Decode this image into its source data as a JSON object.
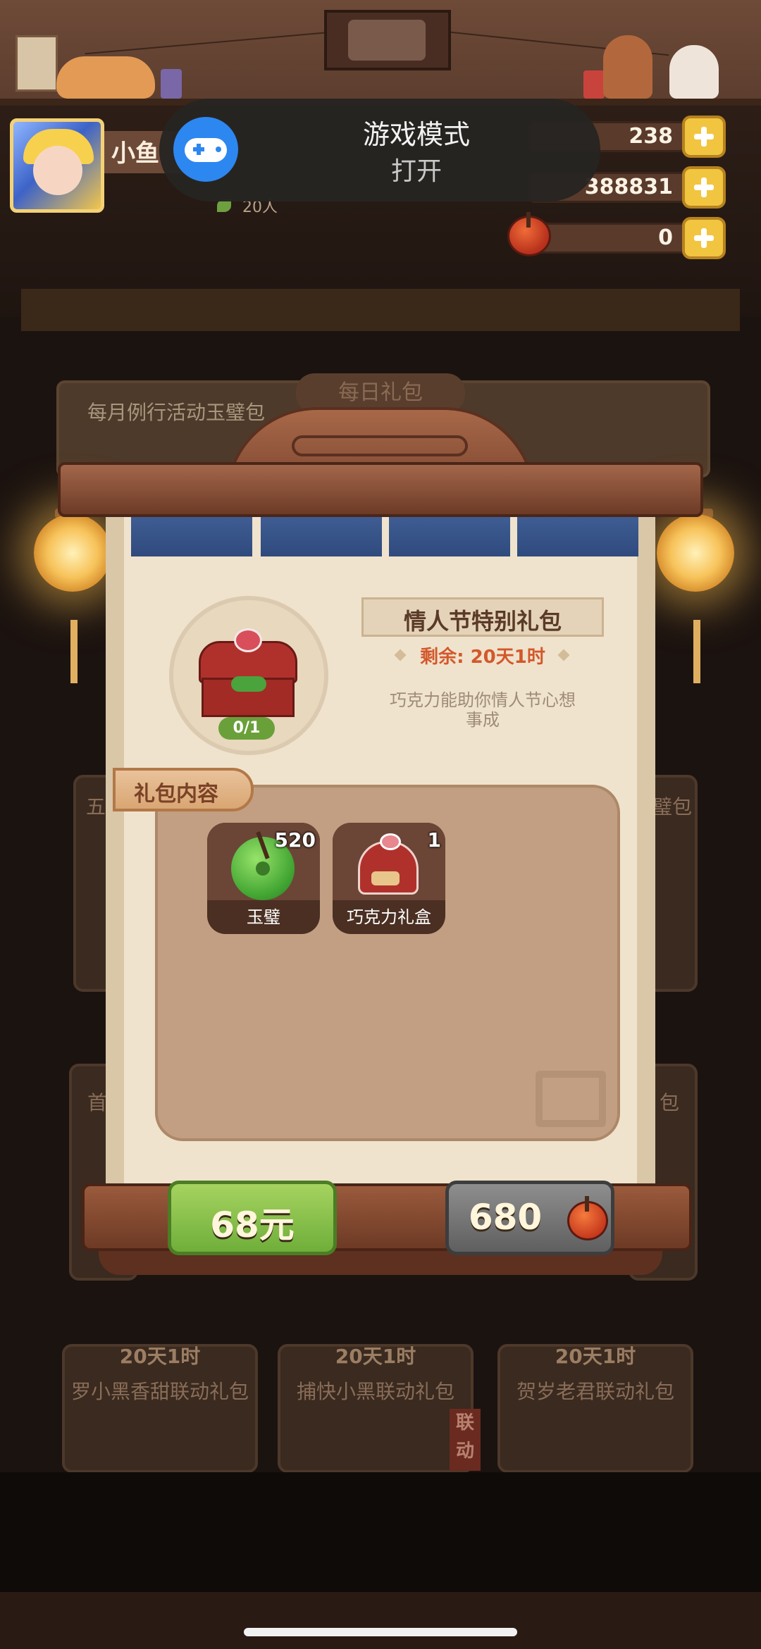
{
  "hud": {
    "player_name": "小鱼",
    "sub_count": "20人",
    "resources": [
      {
        "name": "gems",
        "value": "238"
      },
      {
        "name": "coins",
        "value": "388831"
      },
      {
        "name": "red-jade",
        "value": "0"
      }
    ]
  },
  "game_mode": {
    "title": "游戏模式",
    "state": "打开",
    "accent": "#2d87f0"
  },
  "background": {
    "tab_label": "每日礼包",
    "header_text": "每月例行活动玉璧包",
    "side_left": "五",
    "side_right": "璧包",
    "side_left2": "首",
    "side_right2": "包",
    "bottom_cards": [
      {
        "timer": "20天1时",
        "name": "罗小黑香甜联动礼包"
      },
      {
        "timer": "20天1时",
        "name": "捕快小黑联动礼包"
      },
      {
        "timer": "20天1时",
        "name": "贺岁老君联动礼包"
      }
    ],
    "ribbon_tag": "联动"
  },
  "modal": {
    "title": "情人节特别礼包",
    "remaining": "剩余: 20天1时",
    "description": "巧克力能助你情人节心想事成",
    "progress": "0/1",
    "content_label": "礼包内容",
    "items": [
      {
        "name": "玉璧",
        "count": "520",
        "icon": "jade-disc-icon"
      },
      {
        "name": "巧克力礼盒",
        "count": "1",
        "icon": "chocolate-gift-box-icon"
      }
    ],
    "buy_cash_label": "68元",
    "buy_jade_label": "680"
  },
  "colors": {
    "accent_green": "#6fae3a",
    "remain_orange": "#d3582c",
    "paper": "#efe3cd"
  }
}
